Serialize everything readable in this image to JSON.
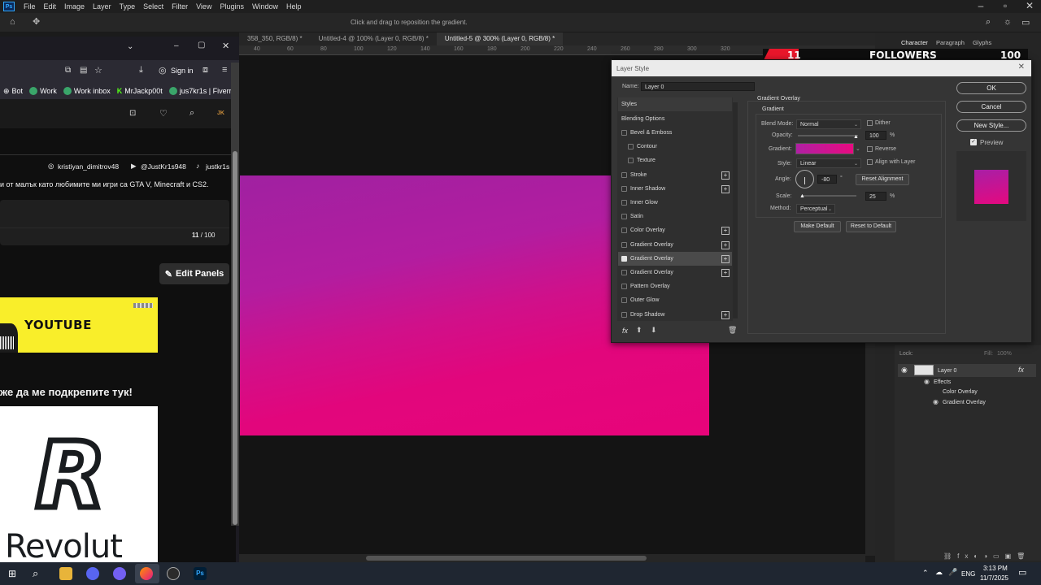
{
  "photoshop": {
    "logo": "Ps",
    "menu": [
      "File",
      "Edit",
      "Image",
      "Layer",
      "Type",
      "Select",
      "Filter",
      "View",
      "Plugins",
      "Window",
      "Help"
    ],
    "options_hint": "Click and drag to reposition the gradient.",
    "doc_tabs": [
      "358_350, RGB/8) *",
      "Untitled-4 @ 100% (Layer 0, RGB/8) *",
      "Untitled-5 @ 300% (Layer 0, RGB/8) *"
    ],
    "ruler_ticks": [
      "40",
      "60",
      "80",
      "100",
      "120",
      "140",
      "160",
      "180",
      "200",
      "220",
      "240",
      "260",
      "280",
      "300",
      "320"
    ],
    "panel_tabs": [
      "Character",
      "Paragraph",
      "Glyphs"
    ],
    "banner": {
      "count": "11",
      "label": "FOLLOWERS",
      "goal": "100"
    },
    "layers": {
      "lock_label": "Lock:",
      "fill_label": "Fill:",
      "fill_value": "100%",
      "layer_name": "Layer 0",
      "effects_label": "Effects",
      "effect_items": [
        "Color Overlay",
        "Gradient Overlay"
      ]
    }
  },
  "layer_style": {
    "title": "Layer Style",
    "name_label": "Name:",
    "name_value": "Layer 0",
    "styles_header": "Styles",
    "blending_options": "Blending Options",
    "items": [
      {
        "label": "Bevel & Emboss",
        "checked": false,
        "plus": false
      },
      {
        "label": "Contour",
        "checked": false,
        "plus": false
      },
      {
        "label": "Texture",
        "checked": false,
        "plus": false
      },
      {
        "label": "Stroke",
        "checked": false,
        "plus": true
      },
      {
        "label": "Inner Shadow",
        "checked": false,
        "plus": true
      },
      {
        "label": "Inner Glow",
        "checked": false,
        "plus": false
      },
      {
        "label": "Satin",
        "checked": false,
        "plus": false
      },
      {
        "label": "Color Overlay",
        "checked": false,
        "plus": true
      },
      {
        "label": "Gradient Overlay",
        "checked": false,
        "plus": true
      },
      {
        "label": "Gradient Overlay",
        "checked": true,
        "plus": true
      },
      {
        "label": "Gradient Overlay",
        "checked": false,
        "plus": true
      },
      {
        "label": "Pattern Overlay",
        "checked": false,
        "plus": false
      },
      {
        "label": "Outer Glow",
        "checked": false,
        "plus": false
      },
      {
        "label": "Drop Shadow",
        "checked": false,
        "plus": true
      }
    ],
    "section_title": "Gradient Overlay",
    "group_title": "Gradient",
    "blend_mode_label": "Blend Mode:",
    "blend_mode": "Normal",
    "dither_label": "Dither",
    "opacity_label": "Opacity:",
    "opacity": "100",
    "percent": "%",
    "gradient_label": "Gradient:",
    "reverse_label": "Reverse",
    "style_label": "Style:",
    "style": "Linear",
    "align_label": "Align with Layer",
    "angle_label": "Angle:",
    "angle": "-80",
    "degree": "°",
    "reset_alignment": "Reset Alignment",
    "scale_label": "Scale:",
    "scale": "25",
    "method_label": "Method:",
    "method": "Perceptual",
    "make_default": "Make Default",
    "reset_default": "Reset to Default",
    "ok": "OK",
    "cancel": "Cancel",
    "new_style": "New Style...",
    "preview_label": "Preview",
    "fx": "fx"
  },
  "firefox": {
    "sign_in": "Sign in",
    "bookmarks": [
      "Bot",
      "Work",
      "Work inbox",
      "MrJackp00t",
      "jus7kr1s | Fiverr"
    ],
    "profile_initials": "JK",
    "socials": [
      "kristiyan_dimitrov48",
      "@JustKr1s948",
      "justkr1s"
    ],
    "bio": "и от малък като любимите ми игри са GTA V, Minecraft и CS2.",
    "counter_current": "11",
    "counter_total": " / 100",
    "edit_panels": "Edit Panels",
    "youtube": "YOUTUBE",
    "support_text": "же да ме подкрепите тук!",
    "revolut": "Revolut",
    "revolut_r": "R"
  },
  "taskbar": {
    "lang": "ENG",
    "time": "3:13 PM",
    "date": "11/7/2025"
  }
}
